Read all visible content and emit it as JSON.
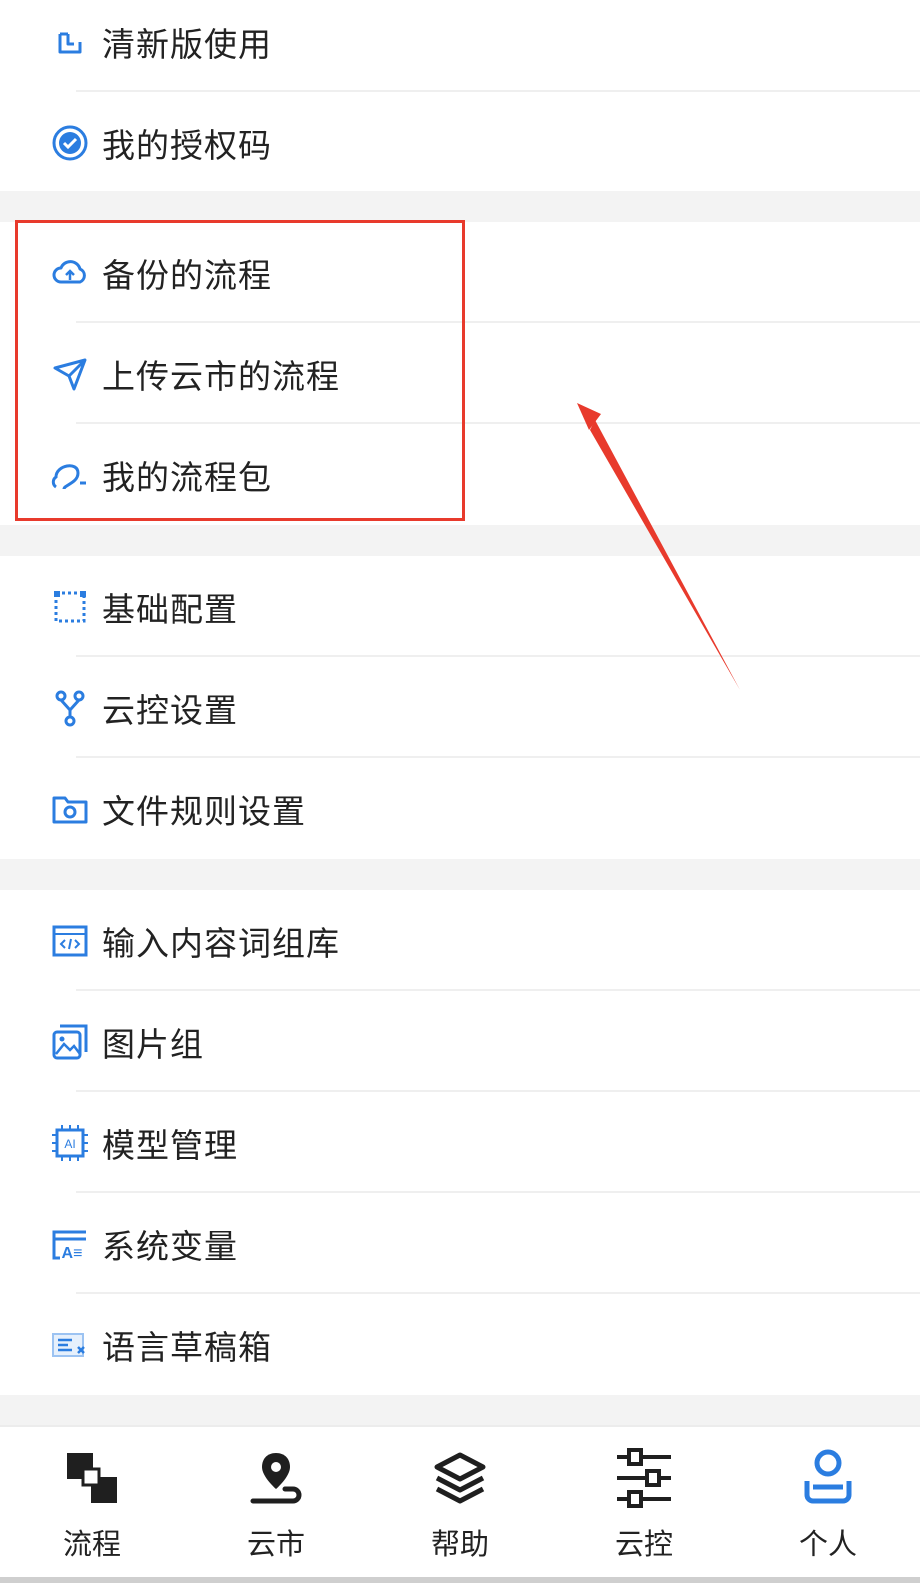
{
  "menu": {
    "group1": [
      {
        "label": "清新版使用",
        "icon": "switch-icon"
      },
      {
        "label": "我的授权码",
        "icon": "verified-badge-icon"
      }
    ],
    "group2": [
      {
        "label": "备份的流程",
        "icon": "cloud-backup-icon"
      },
      {
        "label": "上传云市的流程",
        "icon": "paper-plane-icon"
      },
      {
        "label": "我的流程包",
        "icon": "flow-package-icon"
      }
    ],
    "group3": [
      {
        "label": "基础配置",
        "icon": "dashed-frame-icon"
      },
      {
        "label": "云控设置",
        "icon": "branch-icon"
      },
      {
        "label": "文件规则设置",
        "icon": "folder-gear-icon"
      }
    ],
    "group4": [
      {
        "label": "输入内容词组库",
        "icon": "code-window-icon"
      },
      {
        "label": "图片组",
        "icon": "image-group-icon"
      },
      {
        "label": "模型管理",
        "icon": "ai-chip-icon"
      },
      {
        "label": "系统变量",
        "icon": "variable-icon"
      },
      {
        "label": "语言草稿箱",
        "icon": "draft-box-icon"
      }
    ]
  },
  "tabbar": {
    "items": [
      {
        "label": "流程",
        "icon": "flow-blocks-icon"
      },
      {
        "label": "云市",
        "icon": "location-pin-icon"
      },
      {
        "label": "帮助",
        "icon": "layers-icon"
      },
      {
        "label": "云控",
        "icon": "sliders-icon"
      },
      {
        "label": "个人",
        "icon": "person-icon",
        "active": true
      }
    ]
  },
  "colors": {
    "accent": "#2b7de0",
    "highlight": "#e83a2c",
    "divider_bg": "#f3f3f3"
  }
}
